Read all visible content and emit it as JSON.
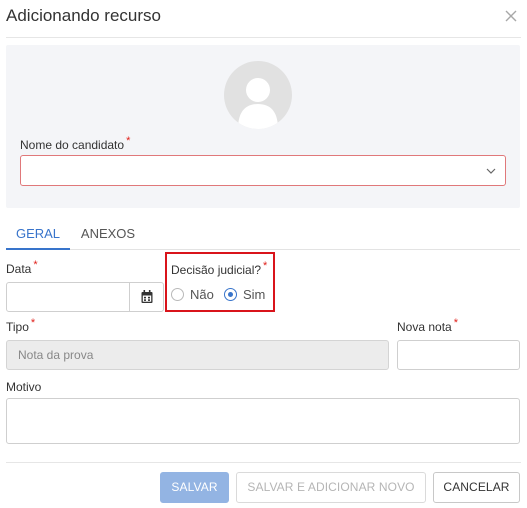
{
  "dialog": {
    "title": "Adicionando recurso"
  },
  "candidate": {
    "label": "Nome do candidato",
    "required_mark": "*",
    "value": ""
  },
  "tabs": [
    {
      "label": "GERAL",
      "active": true
    },
    {
      "label": "ANEXOS",
      "active": false
    }
  ],
  "form": {
    "date": {
      "label": "Data",
      "required_mark": "*",
      "value": ""
    },
    "judicial": {
      "label": "Decisão judicial?",
      "required_mark": "*",
      "options": [
        {
          "label": "Não",
          "checked": false
        },
        {
          "label": "Sim",
          "checked": true
        }
      ]
    },
    "type": {
      "label": "Tipo",
      "required_mark": "*",
      "value": "Nota da prova"
    },
    "new_grade": {
      "label": "Nova nota",
      "required_mark": "*",
      "value": ""
    },
    "reason": {
      "label": "Motivo",
      "value": ""
    }
  },
  "footer": {
    "save_label": "SALVAR",
    "save_new_label": "SALVAR E ADICIONAR NOVO",
    "cancel_label": "CANCELAR"
  },
  "colors": {
    "accent": "#3874cb",
    "required": "#e0201a",
    "highlight": "#d9141b"
  }
}
